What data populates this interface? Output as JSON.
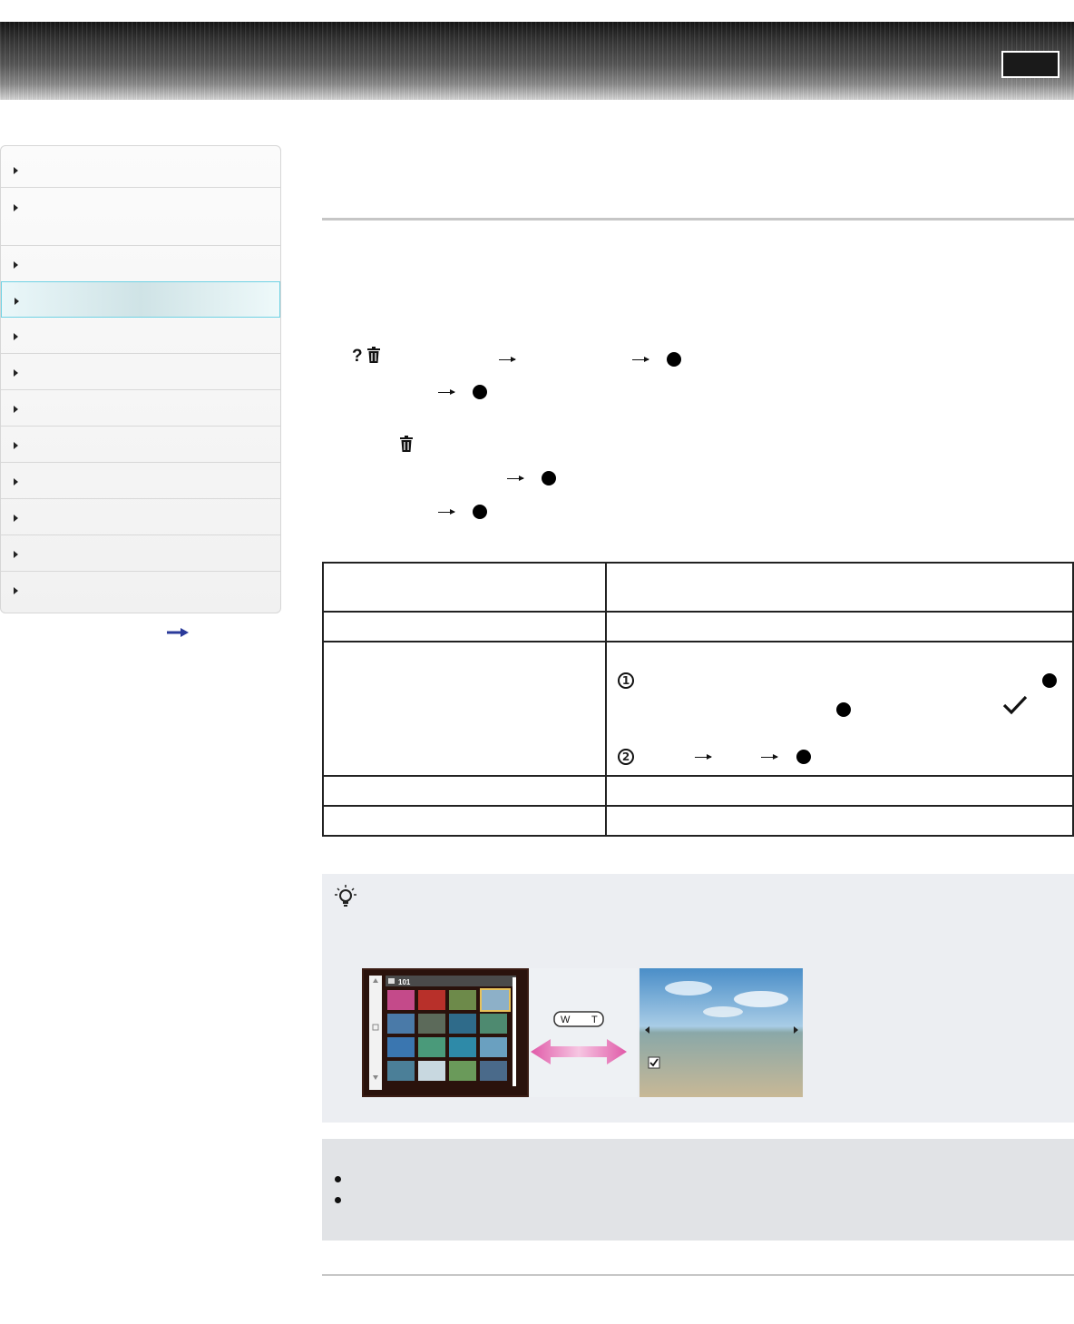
{
  "header": {
    "banner_icon": "striped-banner",
    "button_icon": "outlined-rectangle-button"
  },
  "sidebar": {
    "items_count_note": "",
    "items": [
      {
        "label": ""
      },
      {
        "label": ""
      },
      {
        "label": ""
      },
      {
        "label": "",
        "active": true
      },
      {
        "label": ""
      },
      {
        "label": ""
      },
      {
        "label": ""
      },
      {
        "label": ""
      },
      {
        "label": ""
      },
      {
        "label": ""
      },
      {
        "label": ""
      },
      {
        "label": ""
      }
    ],
    "next_icon": "arrow-right-icon"
  },
  "steps": {
    "icons": [
      "question-mark-icon",
      "trash-icon",
      "arrow-right-icon",
      "center-button-dot-icon"
    ]
  },
  "table": {
    "rows": [
      {
        "option": "",
        "description": ""
      },
      {
        "option": "",
        "description": ""
      },
      {
        "option": "",
        "description": "",
        "markers": [
          "1",
          "2"
        ],
        "check_icon": "checkmark-icon"
      },
      {
        "option": "",
        "description": ""
      },
      {
        "option": "",
        "description": ""
      }
    ]
  },
  "hint": {
    "icon": "lightbulb-icon",
    "illustration": {
      "folder_label": "101",
      "zoom_labels": [
        "W",
        "T"
      ]
    }
  },
  "notes": {
    "items": [
      "",
      ""
    ]
  },
  "colors": {
    "active_nav_border": "#6fd2e4",
    "hint_bg": "#eceef2",
    "note_bg": "#e1e3e6",
    "next_arrow": "#2a3a9a"
  }
}
